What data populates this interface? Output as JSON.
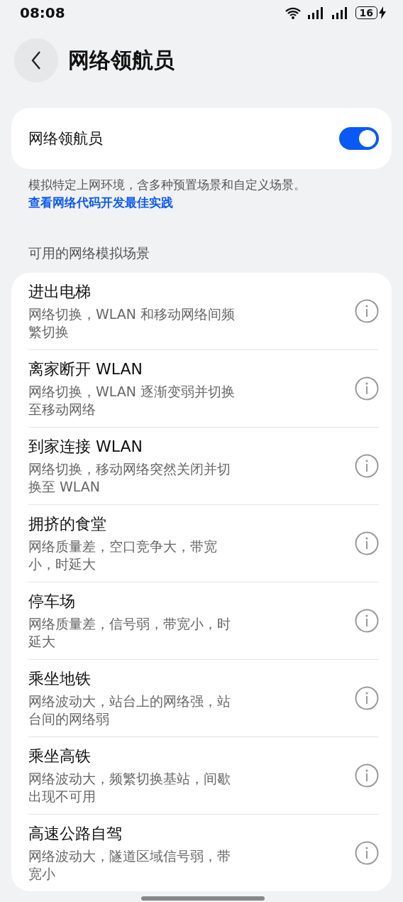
{
  "status_bar": {
    "time": "08:08",
    "battery": "16"
  },
  "header": {
    "title": "网络领航员"
  },
  "toggle_card": {
    "label": "网络领航员",
    "on": true
  },
  "description": {
    "text": "模拟特定上网环境，含多种预置场景和自定义场景。",
    "link": "查看网络代码开发最佳实践"
  },
  "section_title": "可用的网络模拟场景",
  "scenarios": [
    {
      "title": "进出电梯",
      "desc": "网络切换，WLAN 和移动网络间频繁切换"
    },
    {
      "title": "离家断开 WLAN",
      "desc": "网络切换，WLAN 逐渐变弱并切换至移动网络"
    },
    {
      "title": "到家连接 WLAN",
      "desc": "网络切换，移动网络突然关闭并切换至 WLAN"
    },
    {
      "title": "拥挤的食堂",
      "desc": "网络质量差，空口竞争大，带宽小，时延大"
    },
    {
      "title": "停车场",
      "desc": "网络质量差，信号弱，带宽小，时延大"
    },
    {
      "title": "乘坐地铁",
      "desc": "网络波动大，站台上的网络强，站台间的网络弱"
    },
    {
      "title": "乘坐高铁",
      "desc": "网络波动大，频繁切换基站，间歇出现不可用"
    },
    {
      "title": "高速公路自驾",
      "desc": "网络波动大，隧道区域信号弱，带宽小"
    }
  ]
}
